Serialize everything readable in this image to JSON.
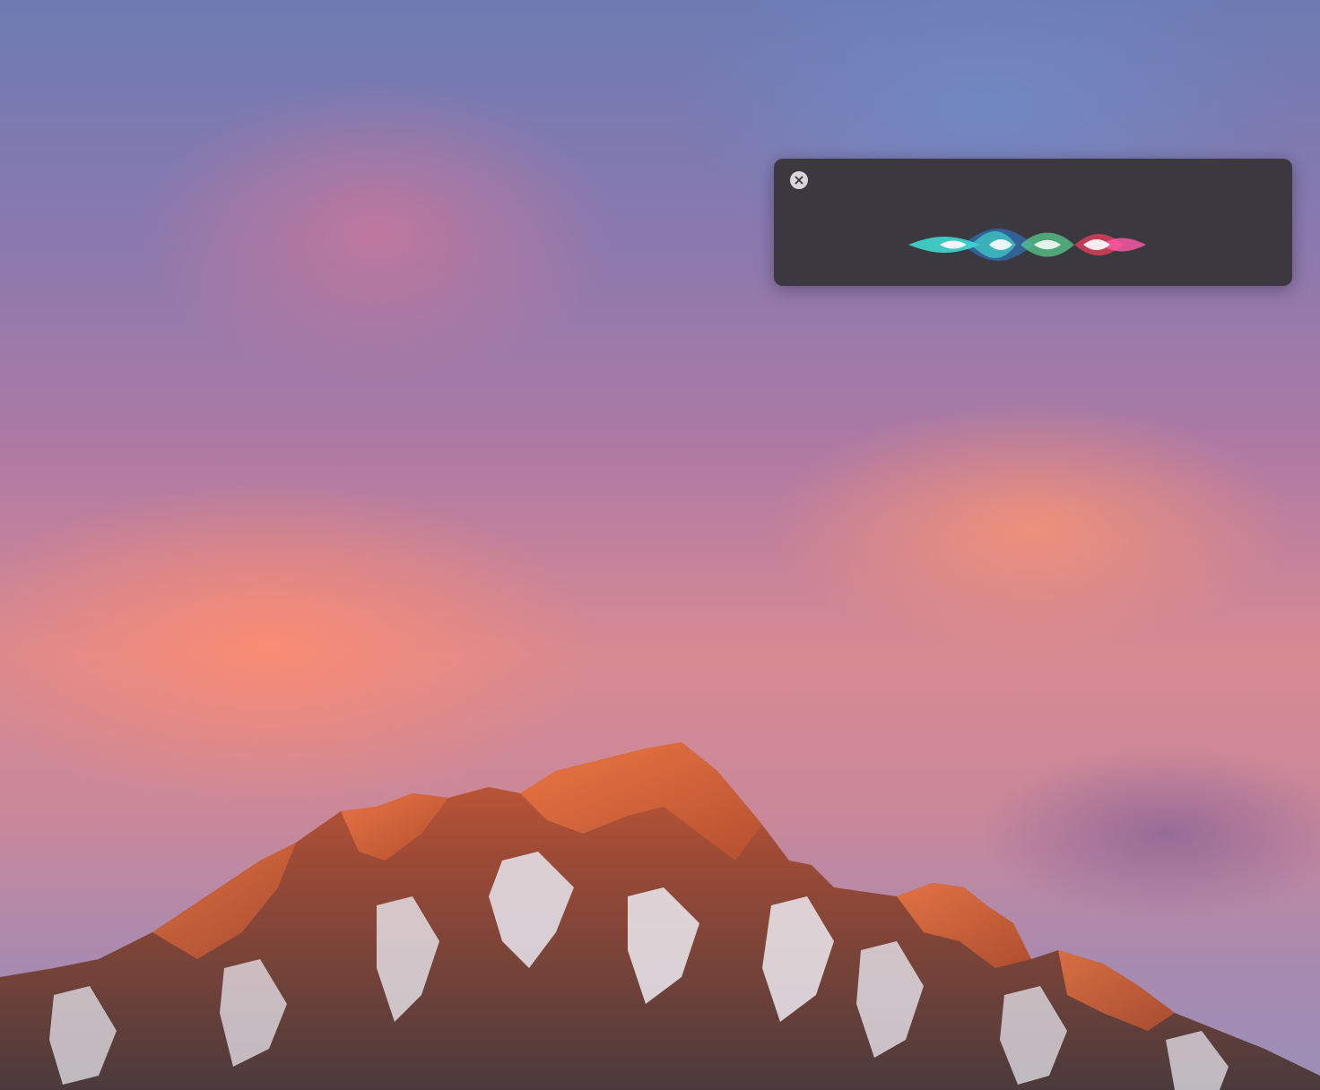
{
  "desktop": {
    "wallpaper": "mountain-sunset-wallpaper"
  },
  "siri": {
    "close_icon": "close-icon",
    "waveform_icon": "siri-waveform-icon",
    "colors": {
      "panel": "#3a363c",
      "cyan": "#3fe1d8",
      "green": "#5fd08f",
      "blue": "#3a7fc4",
      "pink": "#ff5a9a",
      "red": "#e0405a"
    }
  }
}
